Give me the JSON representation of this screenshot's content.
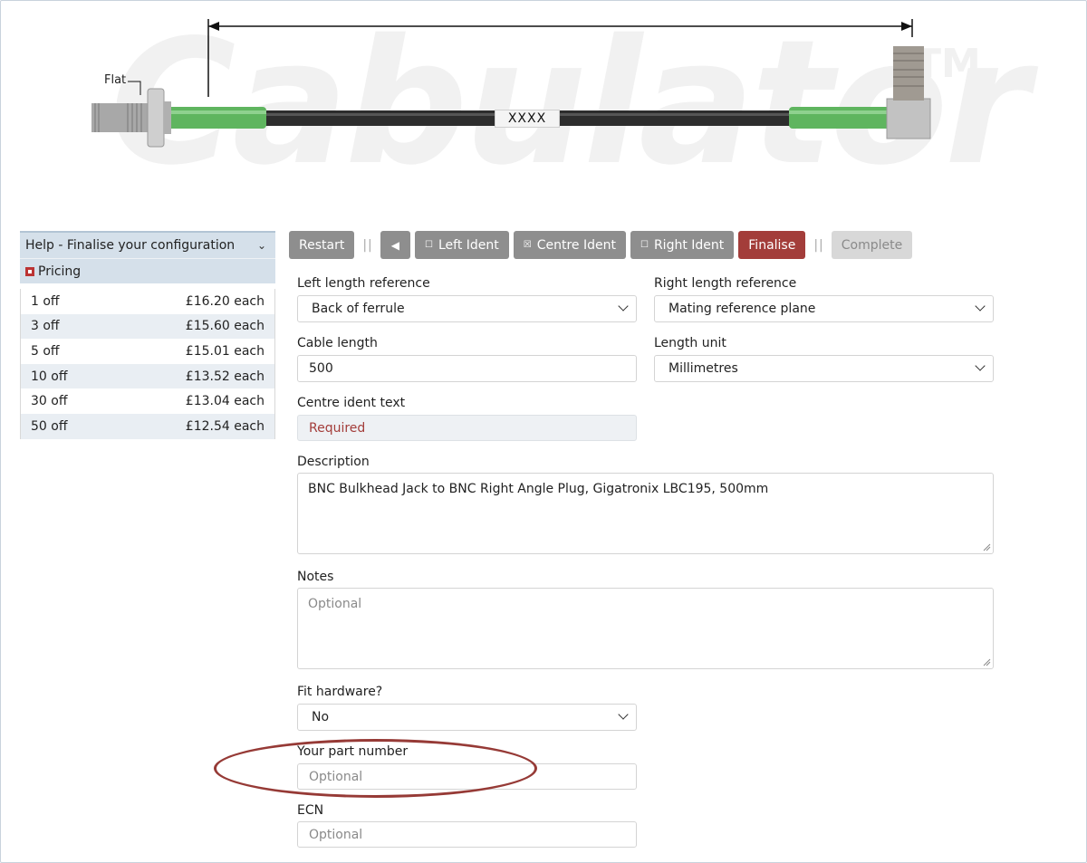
{
  "banner": {
    "flat_label": "Flat",
    "ident_text": "XXXX",
    "watermark": "Cabulator",
    "watermark_tm": "TM"
  },
  "sidebar": {
    "help_label": "Help - Finalise your configuration",
    "pricing_label": "Pricing",
    "prices": [
      {
        "qty": "1 off",
        "price": "£16.20 each"
      },
      {
        "qty": "3 off",
        "price": "£15.60 each"
      },
      {
        "qty": "5 off",
        "price": "£15.01 each"
      },
      {
        "qty": "10 off",
        "price": "£13.52 each"
      },
      {
        "qty": "30 off",
        "price": "£13.04 each"
      },
      {
        "qty": "50 off",
        "price": "£12.54 each"
      }
    ]
  },
  "toolbar": {
    "restart": "Restart",
    "separator": "||",
    "back": "◀",
    "left_ident": "Left Ident",
    "centre_ident": "Centre Ident",
    "right_ident": "Right Ident",
    "finalise": "Finalise",
    "complete": "Complete",
    "unchecked_box": "☐",
    "checked_box": "☒"
  },
  "form": {
    "left_ref_label": "Left length reference",
    "left_ref_value": "Back of ferrule",
    "right_ref_label": "Right length reference",
    "right_ref_value": "Mating reference plane",
    "cable_length_label": "Cable length",
    "cable_length_value": "500",
    "length_unit_label": "Length unit",
    "length_unit_value": "Millimetres",
    "centre_ident_label": "Centre ident text",
    "centre_ident_placeholder": "Required",
    "description_label": "Description",
    "description_value": "BNC Bulkhead Jack to BNC Right Angle Plug, Gigatronix LBC195, 500mm",
    "notes_label": "Notes",
    "notes_placeholder": "Optional",
    "fit_hardware_label": "Fit hardware?",
    "fit_hardware_value": "No",
    "part_number_label": "Your part number",
    "part_number_placeholder": "Optional",
    "ecn_label": "ECN",
    "ecn_placeholder": "Optional"
  },
  "colors": {
    "finalise_red": "#a33d3a",
    "button_grey": "#8e8e8e",
    "sleeve_green": "#5cb85c",
    "highlight_ellipse": "#963a36"
  }
}
